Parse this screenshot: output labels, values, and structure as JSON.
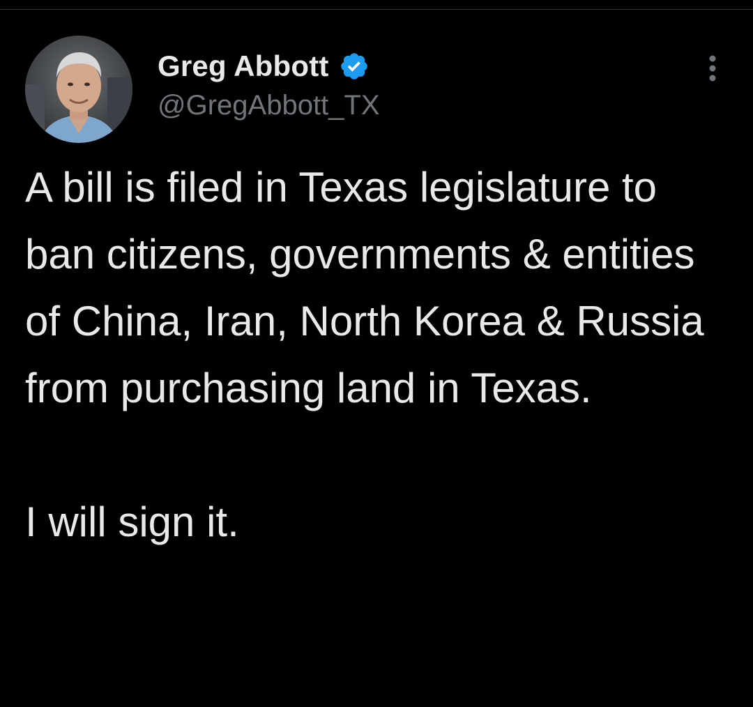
{
  "author": {
    "display_name": "Greg Abbott",
    "handle": "@GregAbbott_TX",
    "verified": true,
    "verified_color": "#1d9bf0",
    "avatar_icon": "profile-photo"
  },
  "tweet": {
    "paragraph_1": "A bill is filed in Texas legislature to ban citizens, governments & entities of China, Iran, North Korea & Russia from purchasing land in Texas.",
    "paragraph_2": "I will sign it."
  },
  "icons": {
    "more": "more-options-icon"
  },
  "colors": {
    "background": "#000000",
    "text_primary": "#e7e9ea",
    "text_secondary": "#71767b"
  }
}
